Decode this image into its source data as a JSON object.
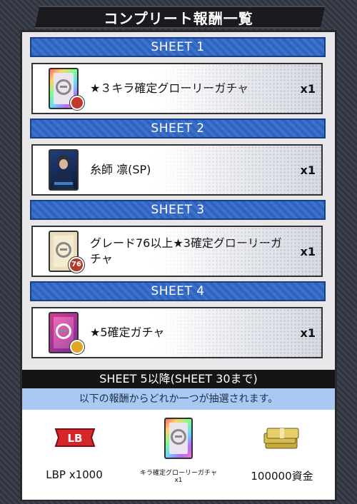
{
  "title": "コンプリート報酬一覧",
  "sheets": [
    {
      "header": "SHEET 1",
      "reward": "★３キラ確定グローリーガチャ",
      "qty": "x1",
      "thumb_icon": "glory-gacha-card-rainbow-icon"
    },
    {
      "header": "SHEET 2",
      "reward": "糸師 凛(SP)",
      "qty": "x1",
      "thumb_icon": "player-card-portrait-icon"
    },
    {
      "header": "SHEET 3",
      "reward": "グレード76以上★3確定グローリーガチャ",
      "qty": "x1",
      "thumb_icon": "glory-gacha-card-cream-icon",
      "badge": "76"
    },
    {
      "header": "SHEET 4",
      "reward": "★5確定ガチャ",
      "qty": "x1",
      "thumb_icon": "gacha-card-pink-icon"
    }
  ],
  "sheet5": {
    "header": "SHEET 5以降(SHEET 30まで)",
    "subtitle": "以下の報酬からどれか一つが抽選されます。",
    "items": [
      {
        "label": "LBP x1000",
        "icon": "lb-point-icon",
        "badge": "LB"
      },
      {
        "label": "キラ確定グローリーガチャ",
        "qty": "x1",
        "icon": "glory-gacha-card-icon"
      },
      {
        "label": "100000資金",
        "icon": "money-stack-icon"
      }
    ]
  },
  "colors": {
    "sheet_header": "#2f63bd",
    "sheet5_header": "#151518",
    "sheet5_sub": "#a9c8f2"
  }
}
